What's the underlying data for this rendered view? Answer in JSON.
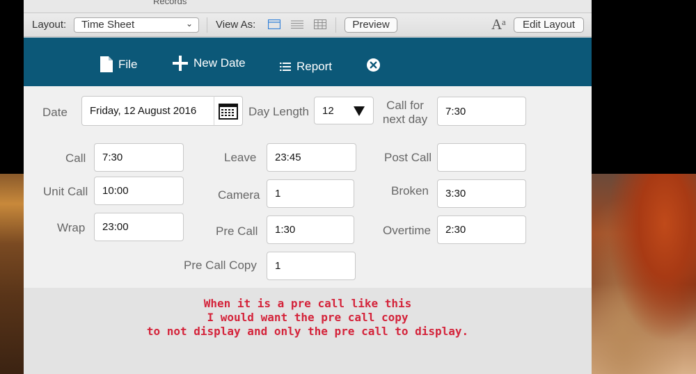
{
  "toolbar": {
    "records_label": "Records",
    "layout_label": "Layout:",
    "layout_value": "Time Sheet",
    "view_as_label": "View As:",
    "preview_label": "Preview",
    "font_icon": "Aᵃ",
    "edit_layout_label": "Edit Layout"
  },
  "nav": {
    "file": "File",
    "new_date": "New Date",
    "report": "Report"
  },
  "form": {
    "date_label": "Date",
    "date_value": "Friday, 12 August 2016",
    "day_length_label": "Day Length",
    "day_length_value": "12",
    "call_next_label_1": "Call for",
    "call_next_label_2": "next day",
    "call_next_value": "7:30",
    "call_label": "Call",
    "call_value": "7:30",
    "leave_label": "Leave",
    "leave_value": "23:45",
    "post_call_label": "Post Call",
    "post_call_value": "",
    "unit_call_label": "Unit Call",
    "unit_call_value": "10:00",
    "camera_label": "Camera",
    "camera_value": "1",
    "broken_label": "Broken",
    "broken_value": "3:30",
    "wrap_label": "Wrap",
    "wrap_value": "23:00",
    "pre_call_label": "Pre Call",
    "pre_call_value": "1:30",
    "overtime_label": "Overtime",
    "overtime_value": "2:30",
    "pre_call_copy_label": "Pre Call Copy",
    "pre_call_copy_value": "1"
  },
  "note": {
    "line1": "When it is a pre call like this",
    "line2": "I would want the pre call copy",
    "line3": "to not display and only the pre call to display."
  },
  "colors": {
    "nav_bg": "#0c5878",
    "note_text": "#d4233a"
  }
}
